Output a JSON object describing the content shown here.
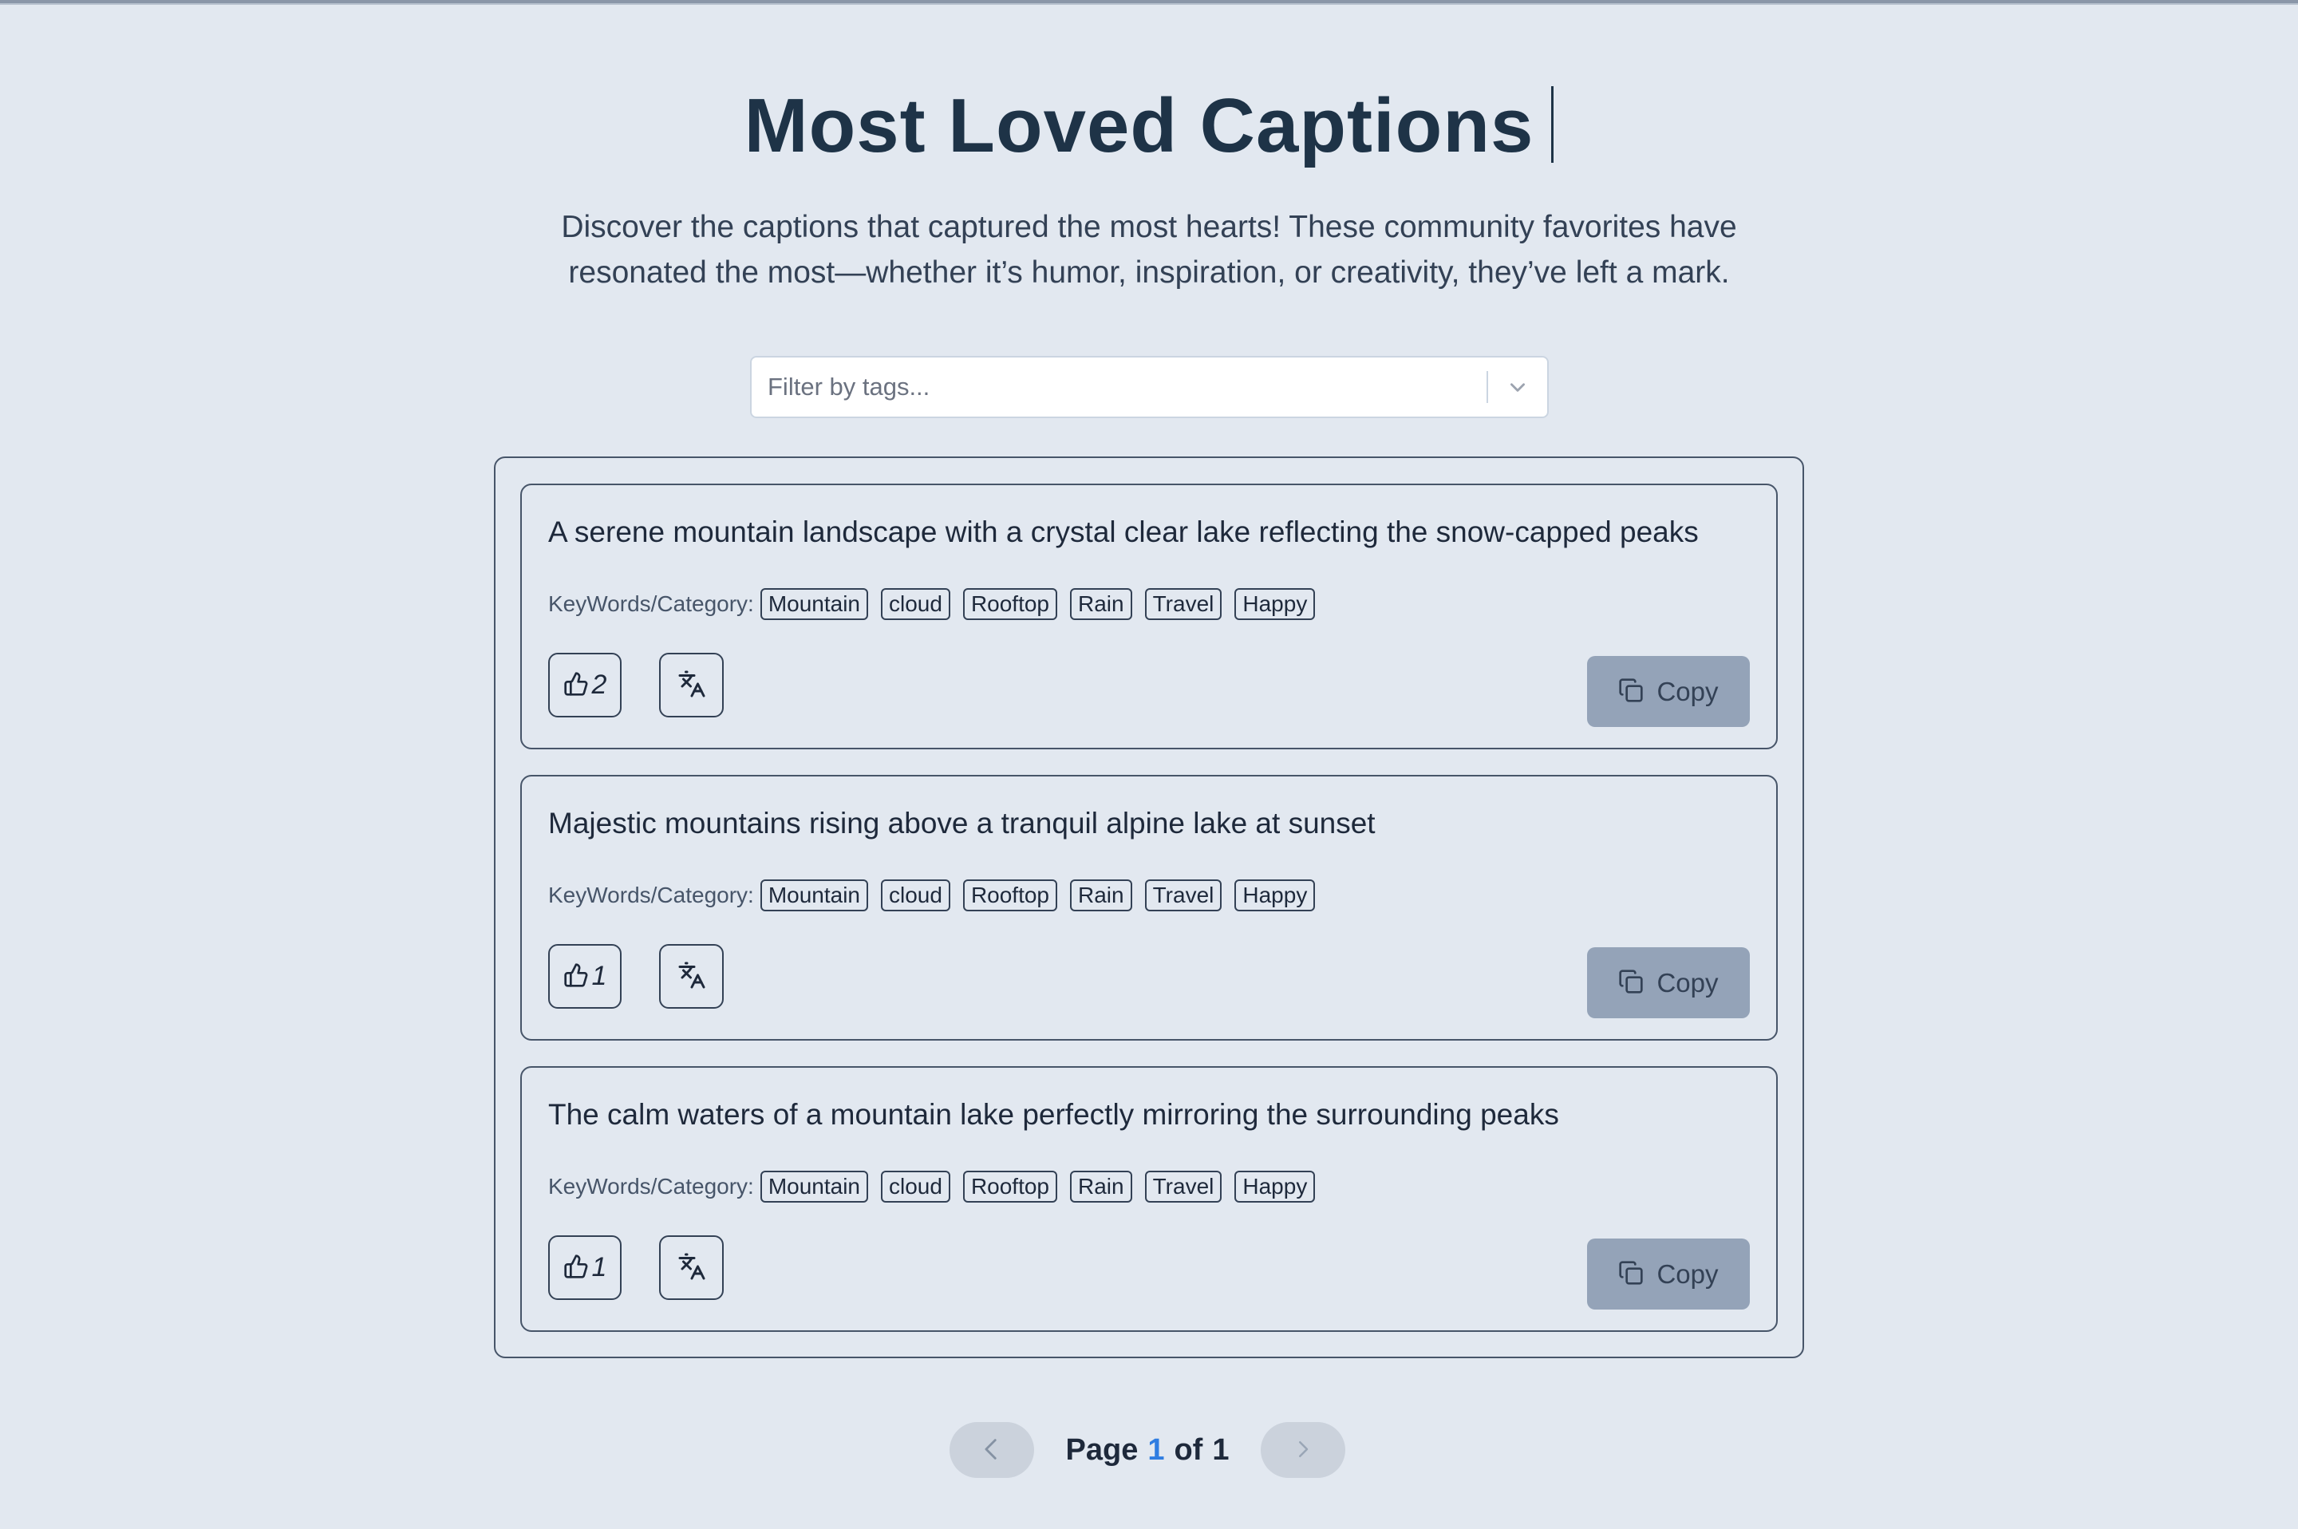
{
  "header": {
    "title": "Most Loved Captions",
    "description": "Discover the captions that captured the most hearts! These community favorites have resonated the most—whether it’s humor, inspiration, or creativity, they’ve left a mark."
  },
  "filter": {
    "placeholder": "Filter by tags...",
    "icon": "chevron-down-icon"
  },
  "keywords_label": "KeyWords/Category:",
  "captions": [
    {
      "text": "A serene mountain landscape with a crystal clear lake reflecting the snow-capped peaks",
      "tags": [
        "Mountain",
        "cloud",
        "Rooftop",
        "Rain",
        "Travel",
        "Happy"
      ],
      "likes": "2",
      "copy_label": "Copy"
    },
    {
      "text": "Majestic mountains rising above a tranquil alpine lake at sunset",
      "tags": [
        "Mountain",
        "cloud",
        "Rooftop",
        "Rain",
        "Travel",
        "Happy"
      ],
      "likes": "1",
      "copy_label": "Copy"
    },
    {
      "text": "The calm waters of a mountain lake perfectly mirroring the surrounding peaks",
      "tags": [
        "Mountain",
        "cloud",
        "Rooftop",
        "Rain",
        "Travel",
        "Happy"
      ],
      "likes": "1",
      "copy_label": "Copy"
    }
  ],
  "pagination": {
    "page_word": "Page",
    "current": "1",
    "of_word": "of",
    "total": "1"
  },
  "colors": {
    "background": "#e2e8f0",
    "copy_button": "#94a3b8",
    "current_page": "#2f7de1"
  }
}
